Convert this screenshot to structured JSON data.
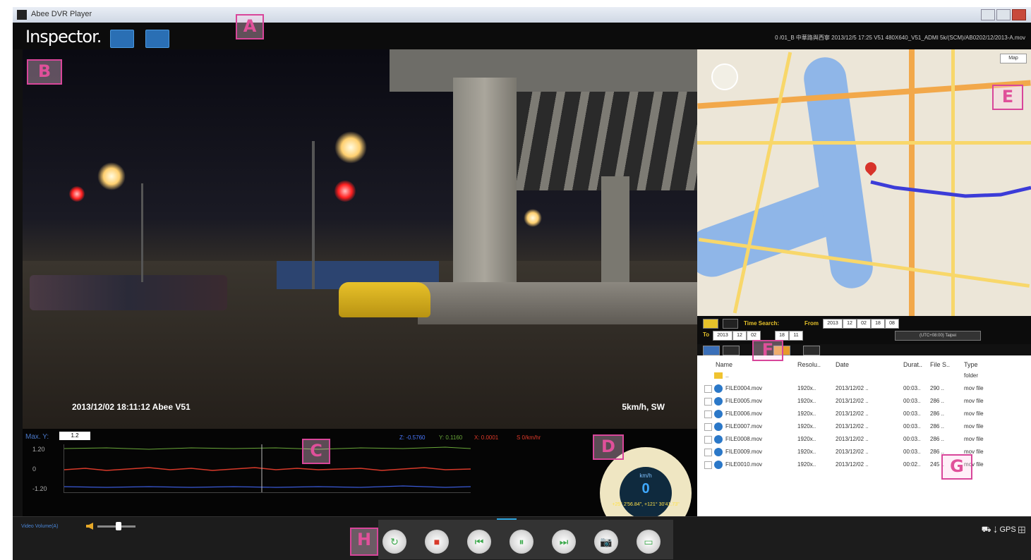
{
  "titlebar": {
    "title": "Abee DVR Player"
  },
  "header": {
    "logo": "Inspector.",
    "file_info": "0 /01_B 中華路與西寧 2013/12/5 17:25 V51 480X640_V51_ADMI 5k/(SCM)/AB0202/12/2013-A.mov"
  },
  "callouts": {
    "a": "A",
    "b": "B",
    "c": "C",
    "d": "D",
    "e": "E",
    "f": "F",
    "g": "G",
    "h": "H"
  },
  "video": {
    "timestamp": "2013/12/02 18:11:12 Abee V51",
    "speed_dir": "5km/h, SW"
  },
  "graph": {
    "max_label": "Max. Y:",
    "max_value": "1.2",
    "legend": {
      "z": "Z: -0.5760",
      "y": "Y: 0.1160",
      "x": "X: 0.0001",
      "speed": "S 0/km/hr"
    },
    "y_labels": [
      "1.20",
      "0",
      "-1.20"
    ],
    "colors": {
      "x": "#d83a2a",
      "y": "#6aa83a",
      "z": "#3a5ad8"
    }
  },
  "gauge": {
    "unit": "km/h",
    "value": "0",
    "coords": "+25° 2'56.84\", +121° 30'41.73\""
  },
  "map": {
    "type_button": "Map"
  },
  "search": {
    "time_search_label": "Time Search:",
    "from_label": "From",
    "from_fields": [
      "2013",
      "12",
      "02",
      "18",
      "08"
    ],
    "to_label": "To",
    "to_fields": [
      "2013",
      "12",
      "02",
      "18",
      "11"
    ],
    "timezone": "(UTC+08:00) Taipei"
  },
  "files": {
    "headers": [
      "Name",
      "Resolu..",
      "Date",
      "Durat..",
      "File S..",
      "Type"
    ],
    "folder": {
      "name": "..",
      "type": "folder"
    },
    "rows": [
      {
        "name": "FILE0004.mov",
        "res": "1920x..",
        "date": "2013/12/02 ..",
        "dur": "00:03..",
        "size": "290 ..",
        "type": "mov file"
      },
      {
        "name": "FILE0005.mov",
        "res": "1920x..",
        "date": "2013/12/02 ..",
        "dur": "00:03..",
        "size": "286 ..",
        "type": "mov file"
      },
      {
        "name": "FILE0006.mov",
        "res": "1920x..",
        "date": "2013/12/02 ..",
        "dur": "00:03..",
        "size": "286 ..",
        "type": "mov file"
      },
      {
        "name": "FILE0007.mov",
        "res": "1920x..",
        "date": "2013/12/02 ..",
        "dur": "00:03..",
        "size": "286 ..",
        "type": "mov file"
      },
      {
        "name": "FILE0008.mov",
        "res": "1920x..",
        "date": "2013/12/02 ..",
        "dur": "00:03..",
        "size": "286 ..",
        "type": "mov file"
      },
      {
        "name": "FILE0009.mov",
        "res": "1920x..",
        "date": "2013/12/02 ..",
        "dur": "00:03..",
        "size": "286 ..",
        "type": "mov file"
      },
      {
        "name": "FILE0010.mov",
        "res": "1920x..",
        "date": "2013/12/02 ..",
        "dur": "00:02..",
        "size": "245 ..",
        "type": "mov file"
      }
    ]
  },
  "bottom": {
    "volume_label": "Video Volume(A)",
    "right_tools": "⛟ ⇣ GPS ⊞"
  },
  "playback": {
    "icons": [
      "↻",
      "■",
      "⏮",
      "⏸",
      "⏭",
      "📷",
      "▭"
    ]
  }
}
